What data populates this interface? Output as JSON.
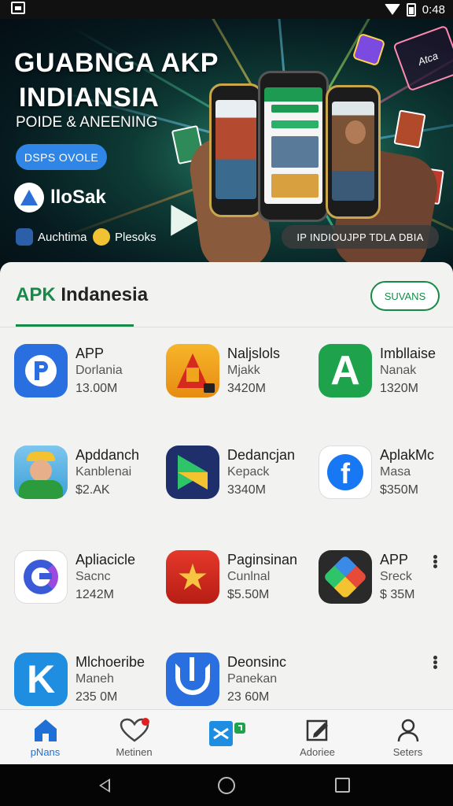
{
  "status_bar": {
    "time": "0:48"
  },
  "hero": {
    "title_line1": "GUABNGA AKP",
    "title_line2": "INDIANSIA",
    "subtitle": "POIDE & ANEENING",
    "cta_label": "DSPS OVOLE",
    "brand_name": "lloSak",
    "chip1_label": "Auchtima",
    "chip2_label": "Plesoks",
    "pill_label": "IP INDIOUJPP TDLA DBIA",
    "tag_text": "Atca"
  },
  "section": {
    "title_accent": "APK",
    "title_rest": " Indanesia",
    "button_label": "SUVANS"
  },
  "apps": [
    {
      "name": "APP",
      "sub": "Dorlania",
      "meta": "13.00M",
      "icon": "parking-p-icon",
      "color": "#2a6fe0"
    },
    {
      "name": "Naljslols",
      "sub": "Mjakk",
      "meta": "3420M",
      "icon": "red-a-icon",
      "color": "#f0a51c"
    },
    {
      "name": "Imbllaise",
      "sub": "Nanak",
      "meta": "1320M",
      "icon": "green-a-icon",
      "color": "#1fa24c"
    },
    {
      "name": "Apddanch",
      "sub": "Kanblenai",
      "meta": "$2.AK",
      "icon": "delivery-man-icon",
      "color": "#3aa0d8"
    },
    {
      "name": "Dedancjan",
      "sub": "Kepack",
      "meta": "3340M",
      "icon": "play-store-icon",
      "color": "#1f2f6b"
    },
    {
      "name": "AplakMc",
      "sub": "Masa",
      "meta": "$350M",
      "icon": "facebook-icon",
      "color": "#ffffff"
    },
    {
      "name": "Apliacicle",
      "sub": "Sacnc",
      "meta": "1242M",
      "icon": "g-logo-icon",
      "color": "#ffffff"
    },
    {
      "name": "Paginsinan",
      "sub": "Cunlnal",
      "meta": "$5.50M",
      "icon": "star-emblem-icon",
      "color": "#d4281e"
    },
    {
      "name": "APP",
      "sub": "Sreck",
      "meta": "$ 35M",
      "icon": "hexagon-cube-icon",
      "color": "#2a2a2a"
    },
    {
      "name": "Mlchoeribe",
      "sub": "Maneh",
      "meta": "235 0M",
      "icon": "k-letter-icon",
      "color": "#1f8ee0"
    },
    {
      "name": "Deonsinc",
      "sub": "Panekan",
      "meta": "23 60M",
      "icon": "sync-arrow-icon",
      "color": "#2a6fe0"
    }
  ],
  "bottom_nav": [
    {
      "label": "pNans",
      "icon": "home-icon",
      "active": true
    },
    {
      "label": "Metinen",
      "icon": "heart-icon",
      "active": false
    },
    {
      "label": "",
      "icon": "cube-x-icon",
      "active": false
    },
    {
      "label": "Adoriee",
      "icon": "edit-icon",
      "active": false
    },
    {
      "label": "Seters",
      "icon": "person-icon",
      "active": false
    }
  ]
}
